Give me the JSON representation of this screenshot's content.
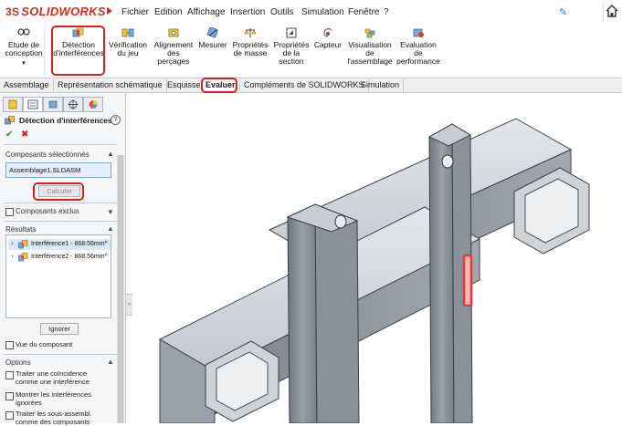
{
  "app": {
    "brand": "SOLIDWORKS",
    "brand_prefix": "3S"
  },
  "menu": [
    "Fichier",
    "Edition",
    "Affichage",
    "Insertion",
    "Outils",
    "Simulation",
    "Fenêtre",
    "?"
  ],
  "ribbon": {
    "etude": "Etude de\nconception",
    "detection": "Détection\nd'interférences",
    "verification": "Vérification\ndu jeu",
    "alignement": "Alignement\ndes\nperçages",
    "mesurer": "Mesurer",
    "proprietes_masse": "Propriétés\nde masse",
    "proprietes_section": "Propriétés\nde la\nsection",
    "capteur": "Capteur",
    "visualisation": "Visualisation\nde\nl'assemblage",
    "evaluation": "Evaluation\nde\nperformance"
  },
  "tabs": [
    "Assemblage",
    "Représentation schématique",
    "Esquisse",
    "Evaluer",
    "Compléments de SOLIDWORKS",
    "Simulation"
  ],
  "active_tab": "Evaluer",
  "panel": {
    "title": "Détection d'interférences",
    "help": "?",
    "ok": "✔",
    "cancel": "✖",
    "selected_header": "Composants sélectionnés",
    "selected_value": "Assemblage1.SLDASM",
    "calculate_btn": "Calculer",
    "excluded_label": "Composants exclus",
    "results_header": "Résultats",
    "results": [
      "Interférence1 - 868.56mm^",
      "Interférence2 - 868.56mm^"
    ],
    "ignore_btn": "Ignorer",
    "component_view": "Vue du composant",
    "options_header": "Options",
    "options": [
      "Traiter une coïncidence comme une interférence",
      "Montrer les interférences ignorées",
      "Traiter les sous-assembl. comme des composants"
    ]
  },
  "colors": {
    "accent_red": "#e01b1b",
    "brand_red": "#d52b1e",
    "interference": "#e23b3b",
    "steel": "#8a8f98"
  }
}
